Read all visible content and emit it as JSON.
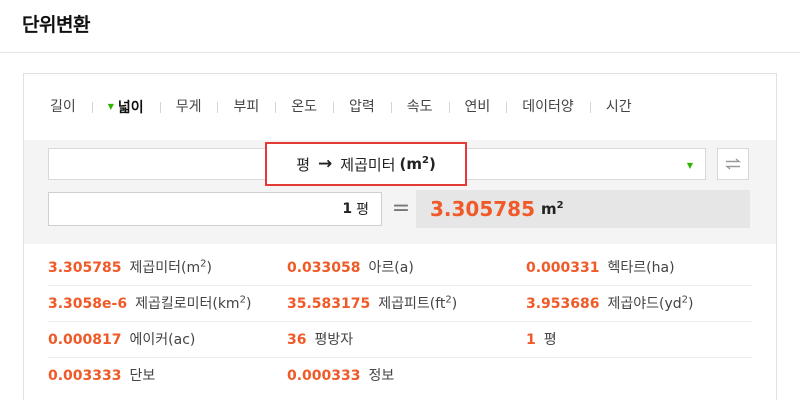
{
  "page": {
    "title": "단위변환"
  },
  "tabs": [
    {
      "label": "길이",
      "active": false
    },
    {
      "label": "넓이",
      "active": true
    },
    {
      "label": "무게",
      "active": false
    },
    {
      "label": "부피",
      "active": false
    },
    {
      "label": "온도",
      "active": false
    },
    {
      "label": "압력",
      "active": false
    },
    {
      "label": "속도",
      "active": false
    },
    {
      "label": "연비",
      "active": false
    },
    {
      "label": "데이터양",
      "active": false
    },
    {
      "label": "시간",
      "active": false
    }
  ],
  "converter": {
    "from_unit": "평",
    "arrow": "→",
    "to_unit_name": "제곱미터",
    "to_unit_open": "(",
    "to_unit_base": "m",
    "to_unit_exp": "2",
    "to_unit_close": ")",
    "input_value": "1",
    "input_unit": "평",
    "equals": "=",
    "result_value": "3.305785",
    "result_unit_base": "m",
    "result_unit_exp": "2"
  },
  "results": [
    [
      {
        "value": "3.305785",
        "unit": "제곱미터(m",
        "exp": "2",
        "tail": ")"
      },
      {
        "value": "0.033058",
        "unit": "아르(a)",
        "exp": "",
        "tail": ""
      },
      {
        "value": "0.000331",
        "unit": "헥타르(ha)",
        "exp": "",
        "tail": ""
      }
    ],
    [
      {
        "value": "3.3058e-6",
        "unit": "제곱킬로미터(km",
        "exp": "2",
        "tail": ")"
      },
      {
        "value": "35.583175",
        "unit": "제곱피트(ft",
        "exp": "2",
        "tail": ")"
      },
      {
        "value": "3.953686",
        "unit": "제곱야드(yd",
        "exp": "2",
        "tail": ")"
      }
    ],
    [
      {
        "value": "0.000817",
        "unit": "에이커(ac)",
        "exp": "",
        "tail": ""
      },
      {
        "value": "36",
        "unit": "평방자",
        "exp": "",
        "tail": ""
      },
      {
        "value": "1",
        "unit": "평",
        "exp": "",
        "tail": ""
      }
    ],
    [
      {
        "value": "0.003333",
        "unit": "단보",
        "exp": "",
        "tail": ""
      },
      {
        "value": "0.000333",
        "unit": "정보",
        "exp": "",
        "tail": ""
      }
    ]
  ],
  "icons": {
    "active_tab_marker": "triangle-down-icon",
    "dropdown": "caret-down-icon",
    "swap": "swap-arrows-icon"
  },
  "colors": {
    "accent_green": "#2db400",
    "value_orange": "#f05a28",
    "highlight_red": "#e53935"
  }
}
